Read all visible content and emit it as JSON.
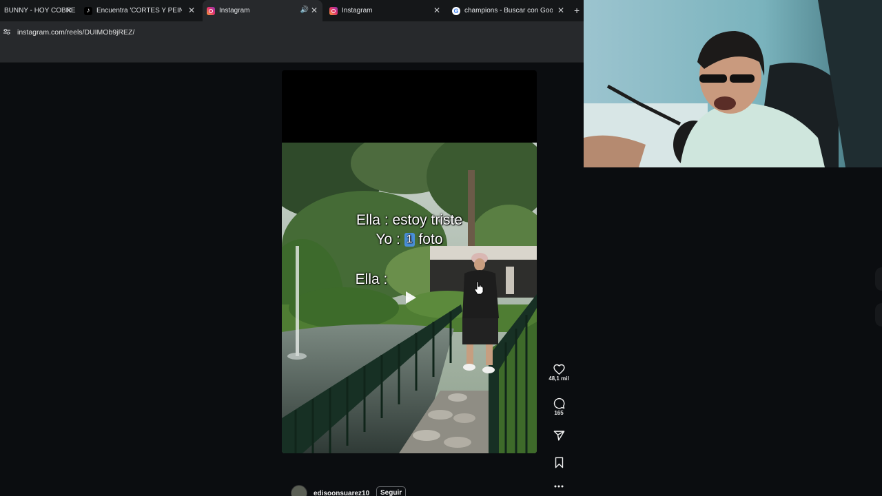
{
  "browser": {
    "tabs": [
      {
        "title": "BUNNY - HOY COBRE",
        "favicon": "music-icon",
        "active": false
      },
      {
        "title": "Encuentra 'CORTES Y PEINADO",
        "favicon": "tiktok-icon",
        "active": false
      },
      {
        "title": "Instagram",
        "favicon": "instagram-icon",
        "active": true,
        "audio": true
      },
      {
        "title": "Instagram",
        "favicon": "instagram-icon",
        "active": false
      },
      {
        "title": "champions - Buscar con Google",
        "favicon": "google-icon",
        "active": false
      }
    ],
    "close_glyph": "✕",
    "new_tab_glyph": "+",
    "url": "instagram.com/reels/DUIMOb9jREZ/"
  },
  "reel": {
    "caption_line1": "Ella : estoy triste",
    "caption_line2_prefix": "Yo : ",
    "caption_line2_emoji": "1",
    "caption_line2_suffix": " foto",
    "caption_line3": "Ella :",
    "author": {
      "username": "edisoonsuarez10",
      "follow_label": "Seguir"
    },
    "actions": {
      "likes": "48,1 mil",
      "comments": "165"
    }
  },
  "colors": {
    "page_bg": "#0b0d10",
    "chrome_bg": "#27292c",
    "tabstrip_bg": "#151719"
  }
}
